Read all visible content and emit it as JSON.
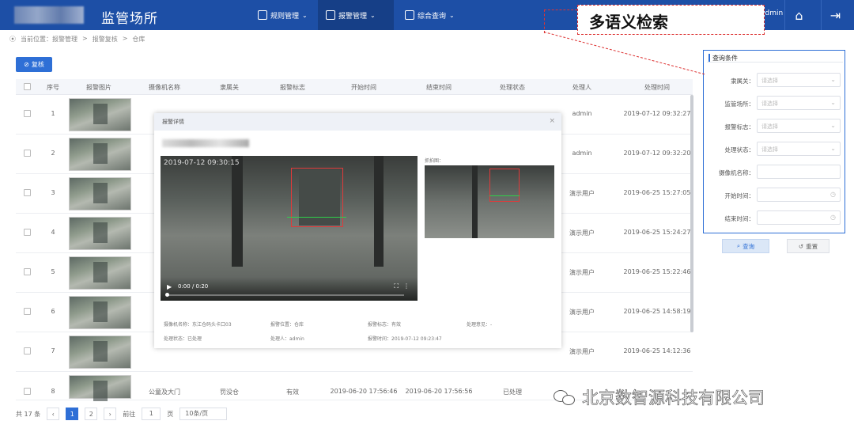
{
  "header": {
    "title": "监管场所",
    "nav": [
      {
        "label": "规则管理"
      },
      {
        "label": "报警管理"
      },
      {
        "label": "综合查询"
      }
    ],
    "user": "admin",
    "callout": "多语义检索"
  },
  "breadcrumb": [
    "当前位置：报警管理",
    ">",
    "报警复核",
    ">",
    "仓库"
  ],
  "toolbar": {
    "review_label": "复核"
  },
  "table": {
    "columns": [
      "序号",
      "报警图片",
      "摄像机名称",
      "隶属关",
      "报警标志",
      "开始时间",
      "结束时间",
      "处理状态",
      "处理人",
      "处理时间"
    ],
    "rows": [
      {
        "idx": "1",
        "handler": "admin",
        "time": "2019-07-12 09:32:27"
      },
      {
        "idx": "2",
        "handler": "admin",
        "time": "2019-07-12 09:32:20"
      },
      {
        "idx": "3",
        "handler": "演示用户",
        "time": "2019-06-25 15:27:05"
      },
      {
        "idx": "4",
        "handler": "演示用户",
        "time": "2019-06-25 15:24:27"
      },
      {
        "idx": "5",
        "handler": "演示用户",
        "time": "2019-06-25 15:22:46"
      },
      {
        "idx": "6",
        "handler": "演示用户",
        "time": "2019-06-25 14:58:19"
      },
      {
        "idx": "7",
        "handler": "演示用户",
        "time": "2019-06-25 14:12:36"
      },
      {
        "idx": "8",
        "camera": "公童及大门",
        "customs": "罚没仓",
        "flag": "有效",
        "start": "2019-06-20 17:56:46",
        "end": "2019-06-20 17:56:56",
        "status": "已处理",
        "handler": "",
        "time": ""
      }
    ]
  },
  "pager": {
    "total": "共 17 条",
    "pages": [
      "1",
      "2"
    ],
    "goto_label": "前往",
    "goto_value": "1",
    "page_unit": "页",
    "size": "10条/页"
  },
  "dialog": {
    "title": "报警详情",
    "video_ts": "2019-07-12 09:30:15",
    "video_time": "0:00 / 0:20",
    "snapshot_label": "抓拍图：",
    "info1": [
      "摄像机名称：东江仓码头卡口03",
      "报警位置：仓库",
      "报警标志：有效",
      "处理意见：-"
    ],
    "info2": [
      "处理状态：已处理",
      "处理人：admin",
      "报警时间：2019-07-12 09:23:47"
    ]
  },
  "search": {
    "title": "查询条件",
    "fields": [
      {
        "label": "隶属关：",
        "placeholder": "请选择"
      },
      {
        "label": "监管场所：",
        "placeholder": "请选择"
      },
      {
        "label": "报警标志：",
        "placeholder": "请选择"
      },
      {
        "label": "处理状态：",
        "placeholder": "请选择"
      },
      {
        "label": "摄像机名称：",
        "placeholder": ""
      },
      {
        "label": "开始时间：",
        "placeholder": ""
      },
      {
        "label": "结束时间：",
        "placeholder": ""
      }
    ],
    "query_label": "查询",
    "reset_label": "重置"
  },
  "watermark": "北京数智源科技有限公司",
  "colors": {
    "primary": "#1d4fa6",
    "accent": "#2e6fd6",
    "callout": "#dd3333"
  }
}
